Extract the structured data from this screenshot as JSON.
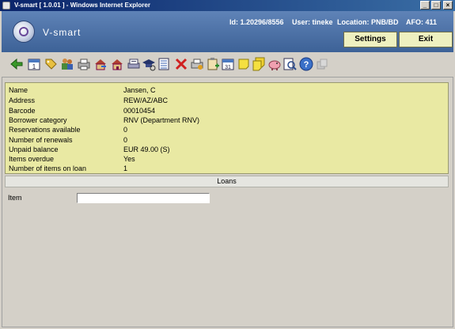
{
  "window": {
    "title": "V-smart [ 1.0.01 ] - Windows Internet Explorer"
  },
  "header": {
    "logo_text": "V-smart",
    "id": "Id: 1.20296/8556",
    "user": "User: tineke",
    "location": "Location: PNB/BD",
    "afo": "AFO: 411",
    "settings_label": "Settings",
    "exit_label": "Exit"
  },
  "toolbar": {
    "icons": [
      "back-arrow-icon",
      "calendar-icon",
      "tag-icon",
      "users-icon",
      "print-icon",
      "house-arrow-icon",
      "house-icon",
      "printer-stack-icon",
      "graduation-icon",
      "list-icon",
      "delete-x-icon",
      "print-settings-icon",
      "clipboard-add-icon",
      "calendar-31-icon",
      "note-icon",
      "notes-icon",
      "piggy-bank-icon",
      "search-document-icon",
      "help-icon",
      "disabled-icon"
    ]
  },
  "borrower": {
    "rows": [
      {
        "label": "Name",
        "value": "Jansen, C"
      },
      {
        "label": "Address",
        "value": "REW/AZ/ABC"
      },
      {
        "label": "Barcode",
        "value": "00010454"
      },
      {
        "label": "Borrower category",
        "value": "RNV (Department RNV)"
      },
      {
        "label": "Reservations available",
        "value": "0"
      },
      {
        "label": "Number of renewals",
        "value": "0"
      },
      {
        "label": "Unpaid balance",
        "value": "EUR 49.00 (S)"
      },
      {
        "label": "Items overdue",
        "value": "Yes"
      },
      {
        "label": "Number of items on loan",
        "value": "1"
      }
    ]
  },
  "loans": {
    "title": "Loans",
    "item_label": "Item",
    "item_value": ""
  }
}
